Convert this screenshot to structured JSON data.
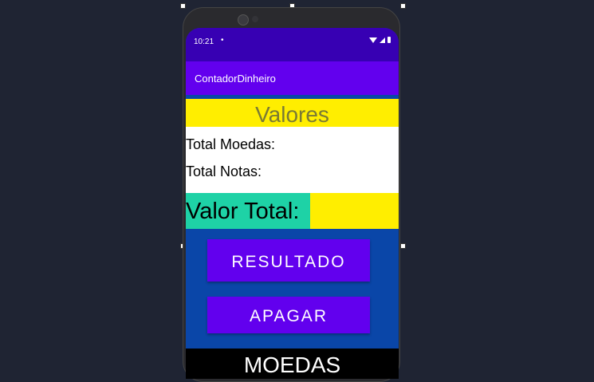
{
  "status_bar": {
    "time": "10:21",
    "dot": "•"
  },
  "app_bar": {
    "title": "ContadorDinheiro"
  },
  "values": {
    "header": "Valores",
    "total_moedas_label": "Total Moedas:",
    "total_notas_label": "Total Notas:",
    "valor_total_label": "Valor Total:"
  },
  "buttons": {
    "resultado": "RESULTADO",
    "apagar": "APAGAR"
  },
  "moedas_header": "MOEDAS",
  "colors": {
    "status_bar": "#3700b3",
    "app_bar": "#6200ee",
    "background": "#0a46a8",
    "yellow": "#ffee00",
    "teal": "#1ed2a6"
  }
}
